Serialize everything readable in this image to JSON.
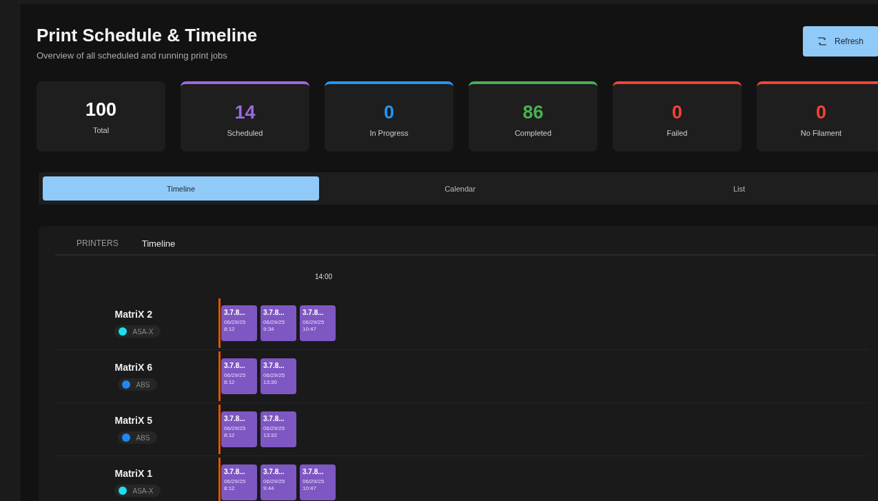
{
  "header": {
    "title": "Print Schedule & Timeline",
    "subtitle": "Overview of all scheduled and running print jobs",
    "refresh_button": "Refresh"
  },
  "stats": [
    {
      "value": "100",
      "label": "Total",
      "color": "#ffffff"
    },
    {
      "value": "14",
      "label": "Scheduled",
      "color": "#9c6ade"
    },
    {
      "value": "0",
      "label": "In Progress",
      "color": "#2196f3"
    },
    {
      "value": "86",
      "label": "Completed",
      "color": "#4caf50"
    },
    {
      "value": "0",
      "label": "Failed",
      "color": "#f44336"
    },
    {
      "value": "0",
      "label": "No Filament",
      "color": "#f44336"
    }
  ],
  "view_tabs": [
    {
      "label": "Timeline",
      "selected": true
    },
    {
      "label": "Calendar",
      "selected": false
    },
    {
      "label": "List",
      "selected": false
    }
  ],
  "timeline": {
    "header_labels": [
      {
        "label": "PRINTERS",
        "selected": false
      },
      {
        "label": "Timeline",
        "selected": true
      }
    ],
    "time_label": "14:00",
    "printers": [
      {
        "name": "MatriX 2",
        "filament": "ASA-X",
        "color": "#18e0f0",
        "jobs": [
          {
            "name": "3.7.8...",
            "date": "06/29/25",
            "time": "8:12"
          },
          {
            "name": "3.7.8...",
            "date": "06/29/25",
            "time": "9:34"
          },
          {
            "name": "3.7.8...",
            "date": "06/29/25",
            "time": "10:47"
          }
        ]
      },
      {
        "name": "MatriX 6",
        "filament": "ABS",
        "color": "#1e88f5",
        "jobs": [
          {
            "name": "3.7.8...",
            "date": "06/29/25",
            "time": "8:12"
          },
          {
            "name": "3.7.8...",
            "date": "06/29/25",
            "time": "13:30"
          }
        ]
      },
      {
        "name": "MatriX 5",
        "filament": "ABS",
        "color": "#1e88f5",
        "jobs": [
          {
            "name": "3.7.8...",
            "date": "06/29/25",
            "time": "8:12"
          },
          {
            "name": "3.7.8...",
            "date": "06/29/25",
            "time": "13:32"
          }
        ]
      },
      {
        "name": "MatriX 1",
        "filament": "ASA-X",
        "color": "#18e0f0",
        "jobs": [
          {
            "name": "3.7.8...",
            "date": "06/29/25",
            "time": "8:12"
          },
          {
            "name": "3.7.8...",
            "date": "06/29/25",
            "time": "9:44"
          },
          {
            "name": "3.7.8...",
            "date": "06/29/25",
            "time": "10:47"
          }
        ]
      }
    ]
  }
}
